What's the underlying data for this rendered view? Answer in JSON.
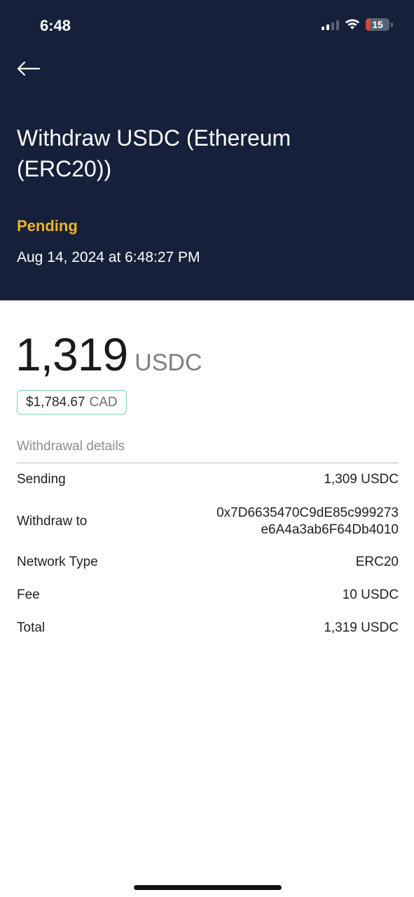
{
  "status_bar": {
    "time": "6:48",
    "battery": "15"
  },
  "header": {
    "back_icon": "arrow-left-icon",
    "title": "Withdraw USDC (Ethereum (ERC20))",
    "status": "Pending",
    "status_color": "#f0b429",
    "date": "Aug 14, 2024 at 6:48:27 PM",
    "background_color": "#16203a"
  },
  "amount": {
    "value": "1,319",
    "unit": "USDC",
    "fiat_value": "$1,784.67",
    "fiat_currency": "CAD"
  },
  "details": {
    "section_title": "Withdrawal details",
    "rows": [
      {
        "label": "Sending",
        "value": "1,309 USDC"
      },
      {
        "label": "Withdraw to",
        "value_line1": "0x7D6635470C9dE85c999273",
        "value_line2": "e6A4a3ab6F64Db4010"
      },
      {
        "label": "Network Type",
        "value": "ERC20"
      },
      {
        "label": "Fee",
        "value": "10 USDC"
      },
      {
        "label": "Total",
        "value": "1,319 USDC"
      }
    ]
  }
}
